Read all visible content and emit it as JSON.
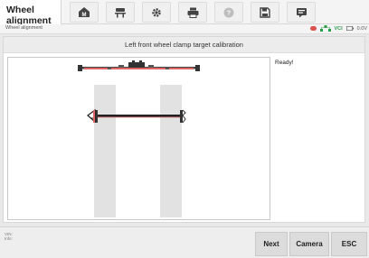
{
  "app": {
    "title": "Wheel alignment"
  },
  "toolbar": {
    "icons": [
      "home-icon",
      "car-lift-icon",
      "gear-icon",
      "print-icon",
      "help-icon",
      "save-icon",
      "message-icon"
    ]
  },
  "infobar": {
    "breadcrumb": "Wheel alignment",
    "vci_label": "VCI",
    "battery_text": "0.0V"
  },
  "panel": {
    "title": "Left front wheel clamp target calibration",
    "status": "Ready!"
  },
  "footer": {
    "vin_line1": "VIN:",
    "vin_line2": "Info:",
    "buttons": {
      "next": "Next",
      "camera": "Camera",
      "esc": "ESC"
    }
  },
  "colors": {
    "accent_red": "#d9534f",
    "vci_green": "#2a9d4b"
  }
}
